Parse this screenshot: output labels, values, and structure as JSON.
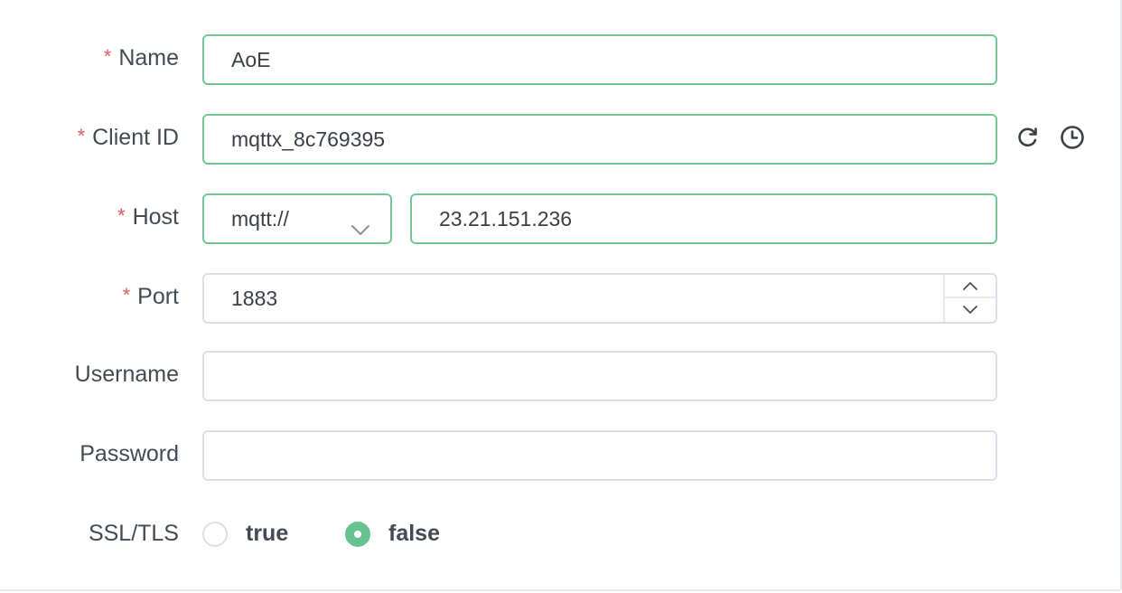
{
  "form": {
    "name": {
      "label": "Name",
      "required_mark": "*",
      "value": "AoE"
    },
    "client_id": {
      "label": "Client ID",
      "required_mark": "*",
      "value": "mqttx_8c769395"
    },
    "host": {
      "label": "Host",
      "required_mark": "*",
      "protocol": "mqtt://",
      "value": "23.21.151.236"
    },
    "port": {
      "label": "Port",
      "required_mark": "*",
      "value": "1883"
    },
    "username": {
      "label": "Username",
      "value": ""
    },
    "password": {
      "label": "Password",
      "value": ""
    },
    "ssl_tls": {
      "label": "SSL/TLS",
      "options": [
        {
          "label": "true",
          "selected": false
        },
        {
          "label": "false",
          "selected": true
        }
      ]
    }
  },
  "icons": {
    "refresh": "refresh-icon",
    "history": "clock-icon",
    "select": "chevron-down-icon",
    "increment": "chevron-up-icon",
    "decrement": "chevron-down-icon"
  },
  "colors": {
    "accent": "#68c290",
    "active_border": "#6fc895",
    "required": "#e0595b",
    "border": "#dcdfe6"
  }
}
